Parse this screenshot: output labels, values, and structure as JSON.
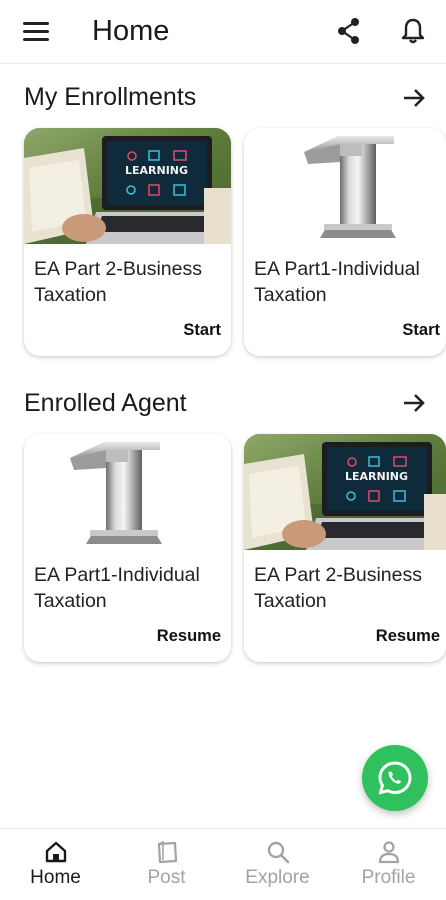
{
  "header": {
    "title": "Home",
    "menu_icon": "hamburger-menu-icon",
    "share_icon": "share-icon",
    "notification_icon": "bell-icon"
  },
  "sections": [
    {
      "title": "My Enrollments",
      "arrow_icon": "arrow-right-icon",
      "courses": [
        {
          "title": "EA Part 2-Business Taxation",
          "action": "Start",
          "thumbnail": "laptop-learning-image"
        },
        {
          "title": "EA Part1-Individual Taxation",
          "action": "Start",
          "thumbnail": "silver-number-one-image"
        }
      ]
    },
    {
      "title": "Enrolled Agent",
      "arrow_icon": "arrow-right-icon",
      "courses": [
        {
          "title": "EA Part1-Individual Taxation",
          "action": "Resume",
          "thumbnail": "silver-number-one-image"
        },
        {
          "title": "EA Part 2-Business Taxation",
          "action": "Resume",
          "thumbnail": "laptop-learning-image"
        }
      ]
    }
  ],
  "fab": {
    "icon": "whatsapp-icon",
    "color": "#2fc15d"
  },
  "bottom_nav": {
    "items": [
      {
        "label": "Home",
        "icon": "home-icon",
        "active": true
      },
      {
        "label": "Post",
        "icon": "post-icon",
        "active": false
      },
      {
        "label": "Explore",
        "icon": "search-icon",
        "active": false
      },
      {
        "label": "Profile",
        "icon": "profile-icon",
        "active": false
      }
    ]
  },
  "colors": {
    "active_nav": "#1a1a1a",
    "inactive_nav": "#a3a3a3"
  }
}
